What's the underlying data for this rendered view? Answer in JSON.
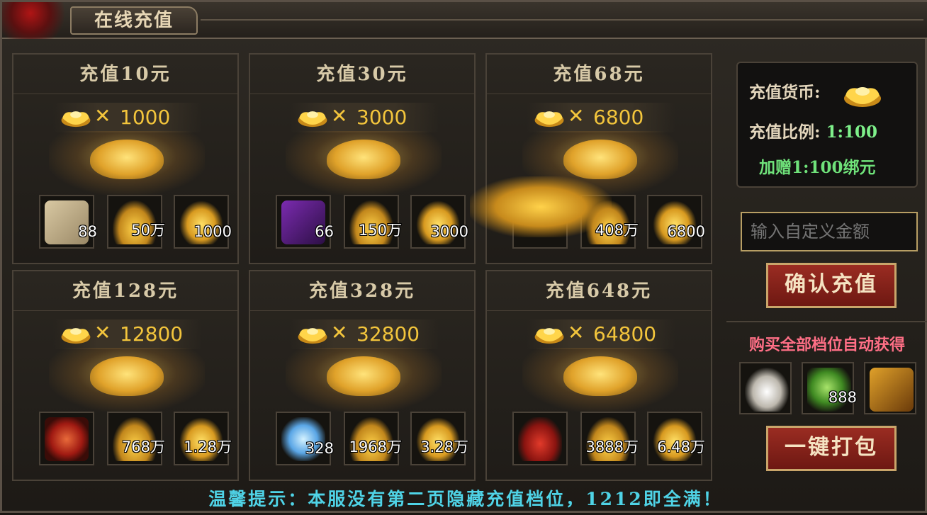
{
  "window": {
    "title": "在线充值"
  },
  "packages": [
    {
      "title": "充值10元",
      "ingots": "1000",
      "items": [
        {
          "icon": "scroll-icon",
          "count": "88"
        },
        {
          "icon": "gold-coins-icon",
          "count": "50万"
        },
        {
          "icon": "gold-ingot-icon",
          "count": "1000"
        }
      ]
    },
    {
      "title": "充值30元",
      "ingots": "3000",
      "items": [
        {
          "icon": "purple-tome-icon",
          "count": "66"
        },
        {
          "icon": "gold-coins-icon",
          "count": "150万"
        },
        {
          "icon": "gold-ingot-icon",
          "count": "3000"
        }
      ]
    },
    {
      "title": "充值68元",
      "ingots": "6800",
      "items": [
        {
          "icon": "hidden-item-icon",
          "count": ""
        },
        {
          "icon": "gold-coins-icon",
          "count": "408万"
        },
        {
          "icon": "gold-ingot-icon",
          "count": "6800"
        }
      ]
    },
    {
      "title": "充值128元",
      "ingots": "12800",
      "items": [
        {
          "icon": "red-drum-icon",
          "count": ""
        },
        {
          "icon": "gold-coins-icon",
          "count": "768万"
        },
        {
          "icon": "gold-ingot-icon",
          "count": "1.28万"
        }
      ]
    },
    {
      "title": "充值328元",
      "ingots": "32800",
      "items": [
        {
          "icon": "blue-spirit-icon",
          "count": "328"
        },
        {
          "icon": "gold-coins-icon",
          "count": "1968万"
        },
        {
          "icon": "gold-ingot-icon",
          "count": "3.28万"
        }
      ]
    },
    {
      "title": "充值648元",
      "ingots": "64800",
      "items": [
        {
          "icon": "red-gourd-icon",
          "count": ""
        },
        {
          "icon": "gold-coins-icon",
          "count": "3888万"
        },
        {
          "icon": "gold-ingot-icon",
          "count": "6.48万"
        }
      ]
    }
  ],
  "times_symbol": "✕",
  "side": {
    "currency_label": "充值货币:",
    "ratio_label": "充值比例:",
    "ratio_value": "1:100",
    "bonus_text": "加赠1:100绑元",
    "input_placeholder": "输入自定义金额",
    "confirm_label": "确认充值",
    "bonus_title": "购买全部档位自动获得",
    "bonus_items": [
      {
        "icon": "white-powder-icon",
        "count": ""
      },
      {
        "icon": "green-herb-icon",
        "count": "888"
      },
      {
        "icon": "treasure-chest-icon",
        "count": ""
      }
    ],
    "pack_label": "一键打包"
  },
  "tip": "温馨提示：本服没有第二页隐藏充值档位，1212即全满！",
  "colors": {
    "gold": "#f3c53c",
    "green": "#7ef08a",
    "pink": "#ff6f86",
    "cyan": "#4fd3e6",
    "button_red": "#8a241b"
  }
}
